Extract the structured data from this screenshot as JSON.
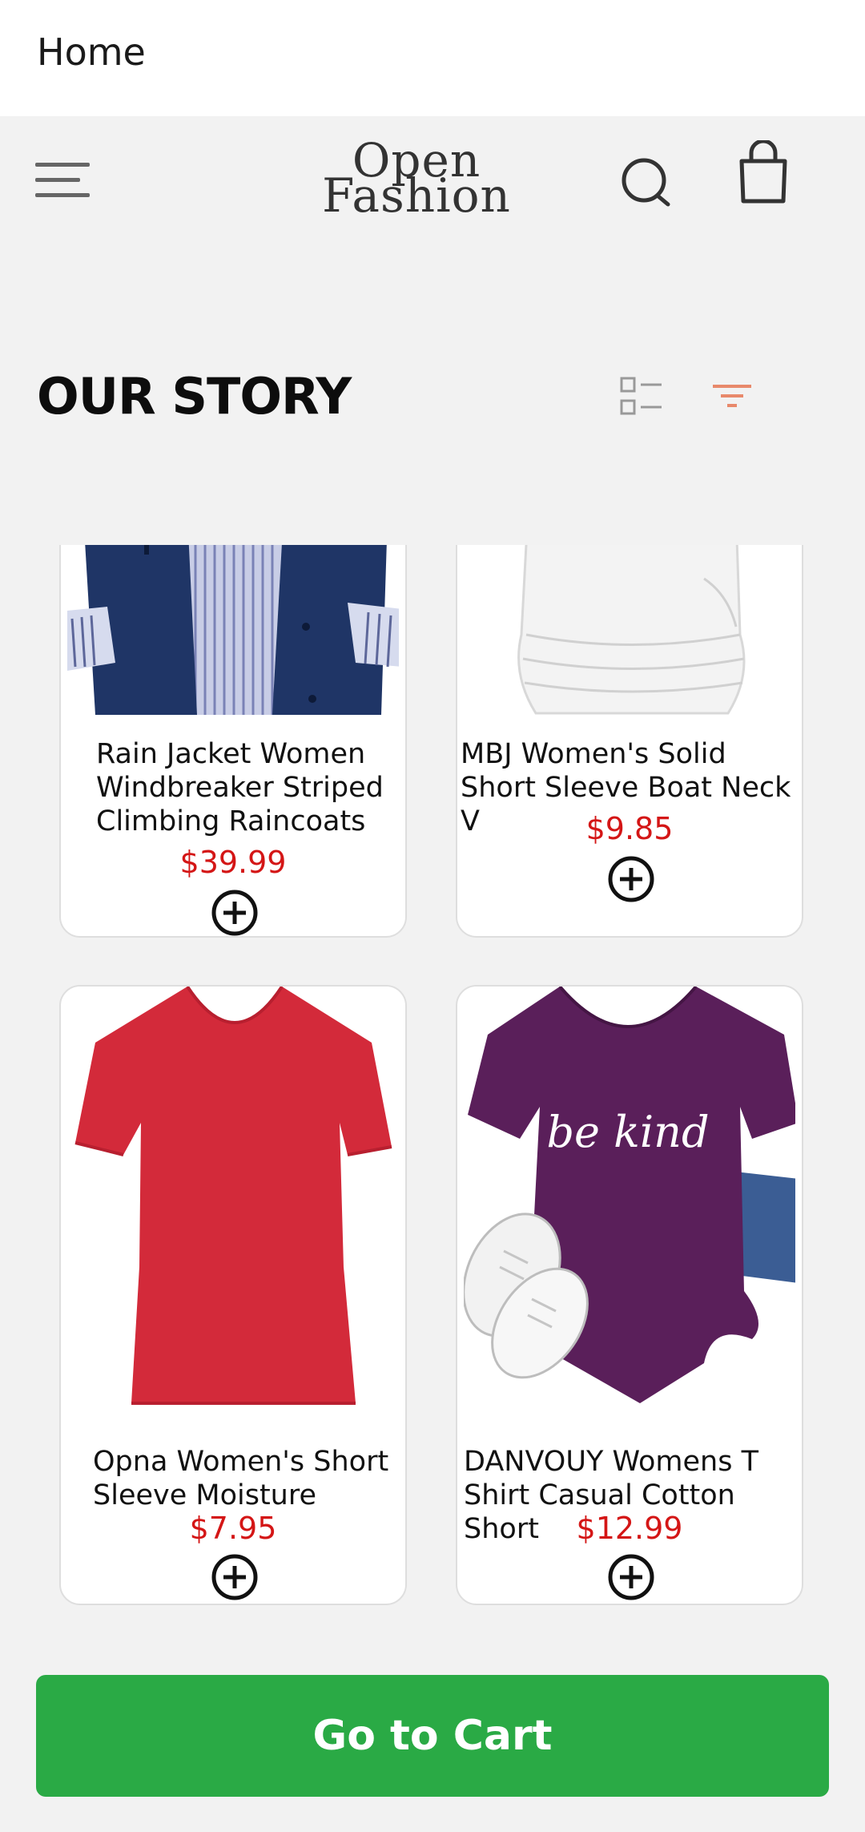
{
  "appbar": {
    "title": "Home"
  },
  "header": {
    "logo_line1": "Open",
    "logo_line2": "Fashion",
    "icons": [
      "menu-icon",
      "search-icon",
      "shopping-bag-icon"
    ]
  },
  "section": {
    "title": "OUR STORY",
    "icons": [
      "list-view-icon",
      "filter-icon"
    ],
    "accent_color": "#e8896b"
  },
  "products": [
    {
      "name": "Rain Jacket Women Windbreaker Striped Climbing Raincoats",
      "price": "$39.99",
      "image": "navy-rain-jacket"
    },
    {
      "name": "MBJ Women's Solid Short Sleeve Boat Neck V",
      "price": "$9.85",
      "image": "white-ruched-top"
    },
    {
      "name": "Opna Women's Short Sleeve Moisture",
      "price": "$7.95",
      "image": "red-v-neck-tshirt"
    },
    {
      "name": "DANVOUY Womens T Shirt Casual Cotton Short",
      "price": "$12.99",
      "image": "purple-be-kind-tshirt",
      "print_text": "be kind"
    }
  ],
  "price_color": "#d41616",
  "cart_button": {
    "label": "Go to Cart",
    "color": "#2aaa45"
  }
}
